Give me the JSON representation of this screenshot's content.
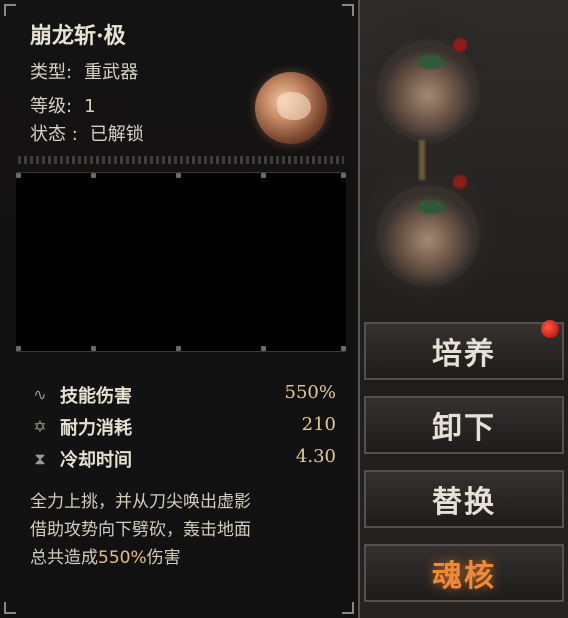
{
  "skill": {
    "title": "崩龙斩·极",
    "type_label": "类型:",
    "type_value": "重武器",
    "level_label": "等级:",
    "level_value": "1",
    "status_label": "状态 :",
    "status_value": "已解锁"
  },
  "stats": [
    {
      "icon": "skill-damage-icon",
      "label": "技能伤害",
      "value": "550%"
    },
    {
      "icon": "stamina-icon",
      "label": "耐力消耗",
      "value": "210"
    },
    {
      "icon": "hourglass-icon",
      "label": "冷却时间",
      "value": "4.30"
    }
  ],
  "description": {
    "line1": "全力上挑，并从刀尖唤出虚影",
    "line2": "借助攻势向下劈砍，轰击地面",
    "line3_pre": "总共造成",
    "line3_hl": "550%",
    "line3_post": "伤害"
  },
  "buttons": {
    "cultivate": "培养",
    "unequip": "卸下",
    "replace": "替换",
    "soul_core": "魂核"
  },
  "colors": {
    "highlight": "#e6bf80",
    "soul_core": "#f08a3a",
    "notification": "#c41c14"
  }
}
